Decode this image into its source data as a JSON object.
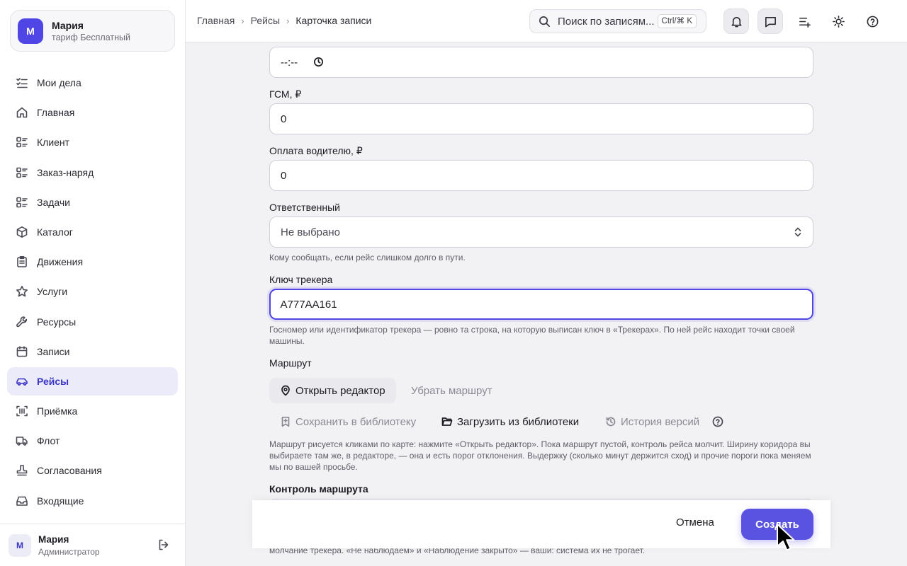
{
  "account": {
    "avatar_letter": "М",
    "name": "Мария",
    "plan": "тариф Бесплатный"
  },
  "nav": [
    {
      "label": "Мои дела",
      "icon": "checklist-icon"
    },
    {
      "label": "Главная",
      "icon": "home-icon"
    },
    {
      "label": "Клиент",
      "icon": "list-icon"
    },
    {
      "label": "Заказ-наряд",
      "icon": "list-icon"
    },
    {
      "label": "Задачи",
      "icon": "list-icon"
    },
    {
      "label": "Каталог",
      "icon": "box-icon"
    },
    {
      "label": "Движения",
      "icon": "clipboard-icon"
    },
    {
      "label": "Услуги",
      "icon": "star-icon"
    },
    {
      "label": "Ресурсы",
      "icon": "wrench-icon"
    },
    {
      "label": "Записи",
      "icon": "calendar-icon"
    },
    {
      "label": "Рейсы",
      "icon": "car-icon",
      "active": true
    },
    {
      "label": "Приёмка",
      "icon": "scan-icon"
    },
    {
      "label": "Флот",
      "icon": "truck-icon"
    },
    {
      "label": "Согласования",
      "icon": "stamp-icon"
    },
    {
      "label": "Входящие",
      "icon": "inbox-icon"
    }
  ],
  "user": {
    "avatar_letter": "М",
    "name": "Мария",
    "role": "Администратор"
  },
  "breadcrumb": {
    "home": "Главная",
    "section": "Рейсы",
    "current": "Карточка записи"
  },
  "search": {
    "placeholder": "Поиск по записям...",
    "shortcut": "Ctrl/⌘ K"
  },
  "form": {
    "time_value": "--:--",
    "fuel_label": "ГСМ, ₽",
    "fuel_value": "0",
    "driver_pay_label": "Оплата водителю, ₽",
    "driver_pay_value": "0",
    "responsible_label": "Ответственный",
    "responsible_value": "Не выбрано",
    "responsible_help": "Кому сообщать, если рейс слишком долго в пути.",
    "tracker_label": "Ключ трекера",
    "tracker_value": "A777AA161",
    "tracker_help": "Госномер или идентификатор трекера — ровно та строка, на которую выписан ключ в «Трекерах». По ней рейс находит точки своей машины.",
    "route_label": "Маршрут",
    "open_editor": "Открыть редактор",
    "remove_route": "Убрать маршрут",
    "save_library": "Сохранить в библиотеку",
    "load_library": "Загрузить из библиотеки",
    "version_history": "История версий",
    "route_help": "Маршрут рисуется кликами по карте: нажмите «Открыть редактор». Пока маршрут пустой, контроль рейса молчит. Ширину коридора вы выбираете там же, в редакторе, — она и есть порог отклонения. Выдержку (сколько минут держится сход) и прочие пороги пока меняем мы по вашей просьбе.",
    "route_control_label": "Контроль маршрута",
    "bottom_help": "молчание трекера. «Не наблюдаем» и «Наблюдение закрыто» — ваши: система их не трогает."
  },
  "actions": {
    "cancel": "Отмена",
    "create": "Создать"
  }
}
